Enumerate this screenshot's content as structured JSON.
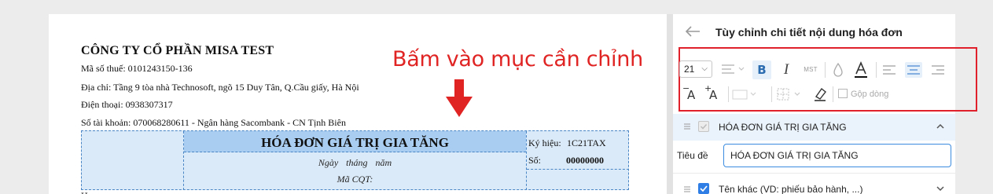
{
  "invoice": {
    "company_name": "CÔNG TY CỔ PHẦN MISA TEST",
    "tax_code": "Mã số thuế: 0101243150-136",
    "address": "Địa chỉ: Tầng 9 tòa nhà Technosoft, ngõ 15 Duy Tân, Q.Cầu giấy, Hà Nội",
    "phone": "Điện thoại: 0938307317",
    "account": "Số tài khoản: 070068280611 - Ngân hàng Sacombank - CN Tịnh Biên",
    "cut_text": "H",
    "title": "HÓA ĐƠN GIÁ TRỊ GIA TĂNG",
    "date_line": "Ngày tháng năm",
    "cqt_line": "Mã CQT:",
    "serial_label": "Ký hiệu:",
    "serial_value": "1C21TAX",
    "number_label": "Số:",
    "number_value": "00000000"
  },
  "annotation": {
    "text": "Bấm vào mục cần chỉnh",
    "color": "#e02424"
  },
  "panel": {
    "back_icon": "arrow-left-icon",
    "title": "Tùy chỉnh chi tiết nội dung hóa đơn",
    "toolbar": {
      "font_size": "21",
      "bold_label": "B",
      "italic_label": "I",
      "mst_label": "MST",
      "decrease_font_label": "A",
      "increase_font_label": "A",
      "merge_rows_label": "Gộp dòng",
      "highlight_color": "#e0202a"
    },
    "section": {
      "label": "HÓA ĐƠN GIÁ TRỊ GIA TĂNG",
      "checked": true
    },
    "title_field": {
      "label": "Tiêu đề",
      "value": "HÓA ĐƠN GIÁ TRỊ GIA TĂNG"
    },
    "other_name": {
      "label": "Tên khác (VD: phiếu bảo hành, ...)",
      "checked": true
    },
    "accent_color": "#2f7ee6"
  }
}
